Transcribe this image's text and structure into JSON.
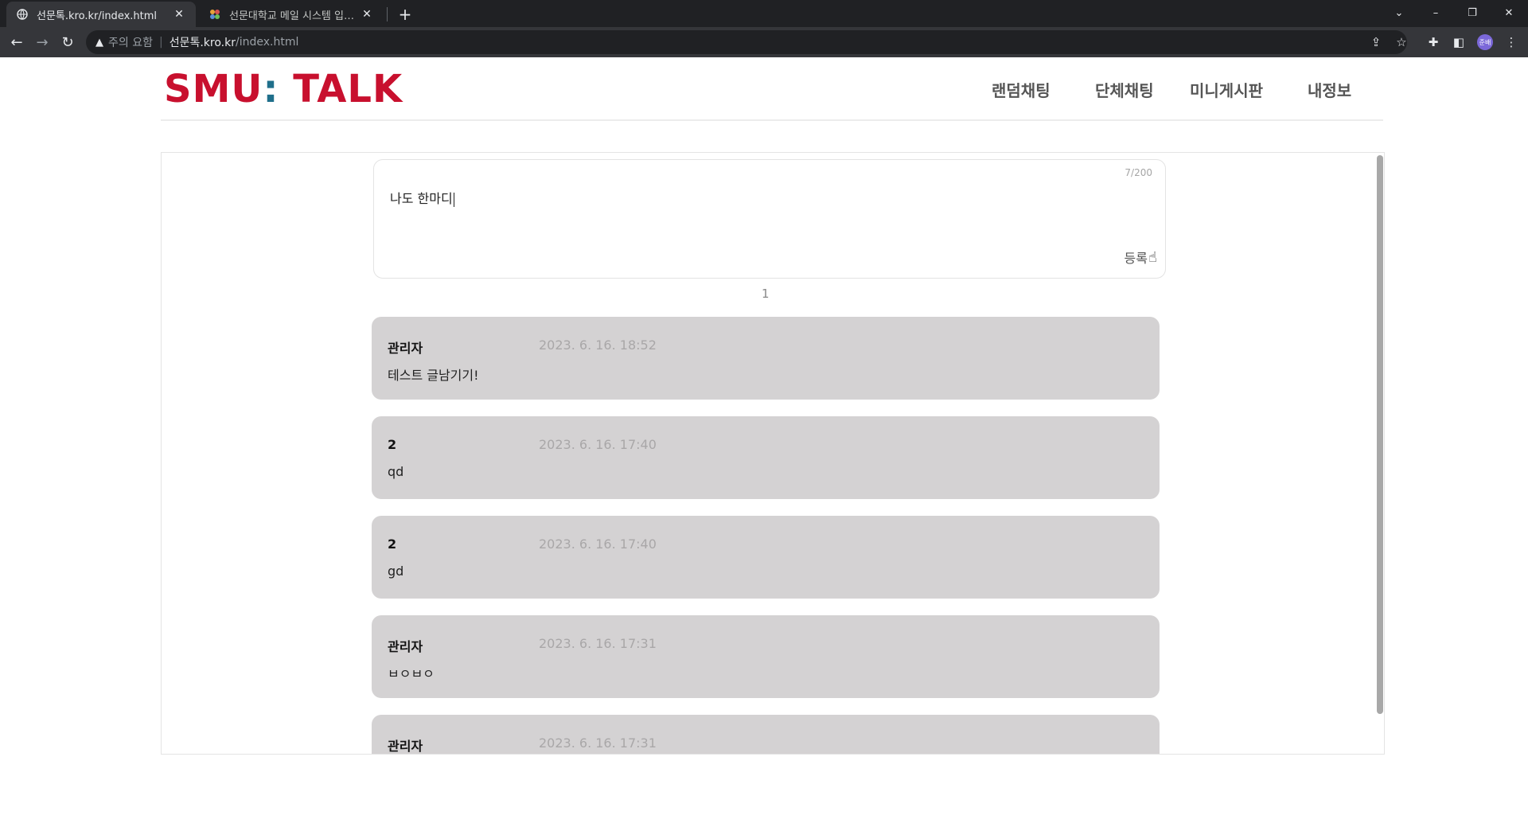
{
  "browser": {
    "tabs": [
      {
        "title": "선문톡.kro.kr/index.html",
        "active": true,
        "favicon": "globe-icon"
      },
      {
        "title": "선문대학교 메일 시스템 입니다.",
        "active": false,
        "favicon": "mail-logo-icon"
      }
    ],
    "address": {
      "security_label": "주의 요함",
      "host": "선문톡.kro.kr",
      "path": "/index.html"
    },
    "profile_initials": "준배"
  },
  "site": {
    "logo_main": "SMU",
    "logo_colon": ":",
    "logo_talk": " TALK",
    "nav": [
      "랜덤채팅",
      "단체채팅",
      "미니게시판",
      "내정보"
    ],
    "colors": {
      "brand": "#c8102e",
      "accent": "#1f6f8b",
      "card": "#d4d2d3"
    }
  },
  "compose": {
    "value": "나도 한마디",
    "counter": "7/200",
    "submit_label": "등록"
  },
  "page_number": "1",
  "posts": [
    {
      "author": "관리자",
      "date": "2023. 6. 16. 18:52",
      "body": "테스트 글남기기!"
    },
    {
      "author": "2",
      "date": "2023. 6. 16. 17:40",
      "body": "qd"
    },
    {
      "author": "2",
      "date": "2023. 6. 16. 17:40",
      "body": "gd"
    },
    {
      "author": "관리자",
      "date": "2023. 6. 16. 17:31",
      "body": "ㅂㅇㅂㅇ"
    },
    {
      "author": "관리자",
      "date": "2023. 6. 16. 17:31",
      "body": ""
    }
  ]
}
